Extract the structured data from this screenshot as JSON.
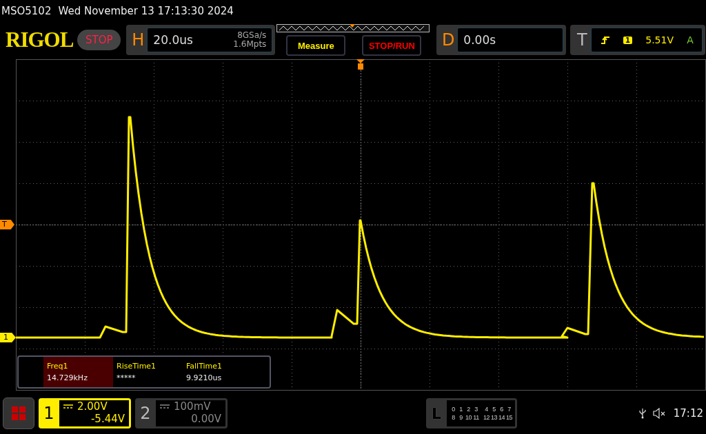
{
  "title_bar": {
    "model": "MSO5102",
    "datetime": "Wed November 13 17:13:30 2024"
  },
  "header": {
    "logo": "RIGOL",
    "run_state": "STOP",
    "horizontal": {
      "label": "H",
      "timebase": "20.0us",
      "sample_rate": "8GSa/s",
      "memory_depth": "1.6Mpts"
    },
    "buttons": [
      {
        "label": "Measure",
        "kind": "measure"
      },
      {
        "label": "STOP/RUN",
        "kind": "run"
      }
    ],
    "delay": {
      "label": "D",
      "value": "0.00s"
    },
    "trigger": {
      "label": "T",
      "source": "1",
      "level": "5.51V",
      "mode": "A"
    }
  },
  "markers": {
    "trigger_level": "T",
    "channel": "1"
  },
  "measurements": [
    {
      "label": "Freq1",
      "value": "14.729kHz",
      "selected": true
    },
    {
      "label": "RiseTime1",
      "value": "*****",
      "selected": false
    },
    {
      "label": "FallTime1",
      "value": "9.9210us",
      "selected": false
    }
  ],
  "channels": [
    {
      "number": "1",
      "scale": "2.00V",
      "offset": "-5.44V",
      "selected": true
    },
    {
      "number": "2",
      "scale": "100mV",
      "offset": "0.00V",
      "selected": false
    }
  ],
  "logic": {
    "label": "L",
    "rows": [
      [
        "0",
        "1",
        "2",
        "3",
        "4",
        "5",
        "6",
        "7"
      ],
      [
        "8",
        "9",
        "10",
        "11",
        "12",
        "13",
        "14",
        "15"
      ]
    ]
  },
  "status": {
    "time": "17:12"
  }
}
